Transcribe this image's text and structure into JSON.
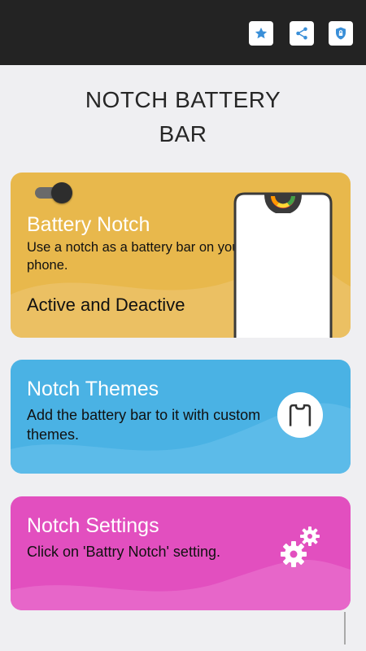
{
  "header": {
    "icons": [
      "star-icon",
      "share-icon",
      "shield-lock-icon"
    ]
  },
  "title": {
    "line1": "NOTCH BATTERY",
    "line2": "BAR"
  },
  "cards": {
    "battery": {
      "title": "Battery Notch",
      "description": "Use a notch as a battery bar on your phone.",
      "status": "Active and Deactive",
      "color": "#e8b84c"
    },
    "themes": {
      "title": "Notch Themes",
      "description": "Add the battery bar to it with custom themes.",
      "color": "#4ab2e4"
    },
    "settings": {
      "title": "Notch Settings",
      "description": "Click on 'Battry Notch' setting.",
      "color": "#e24fbf"
    }
  }
}
